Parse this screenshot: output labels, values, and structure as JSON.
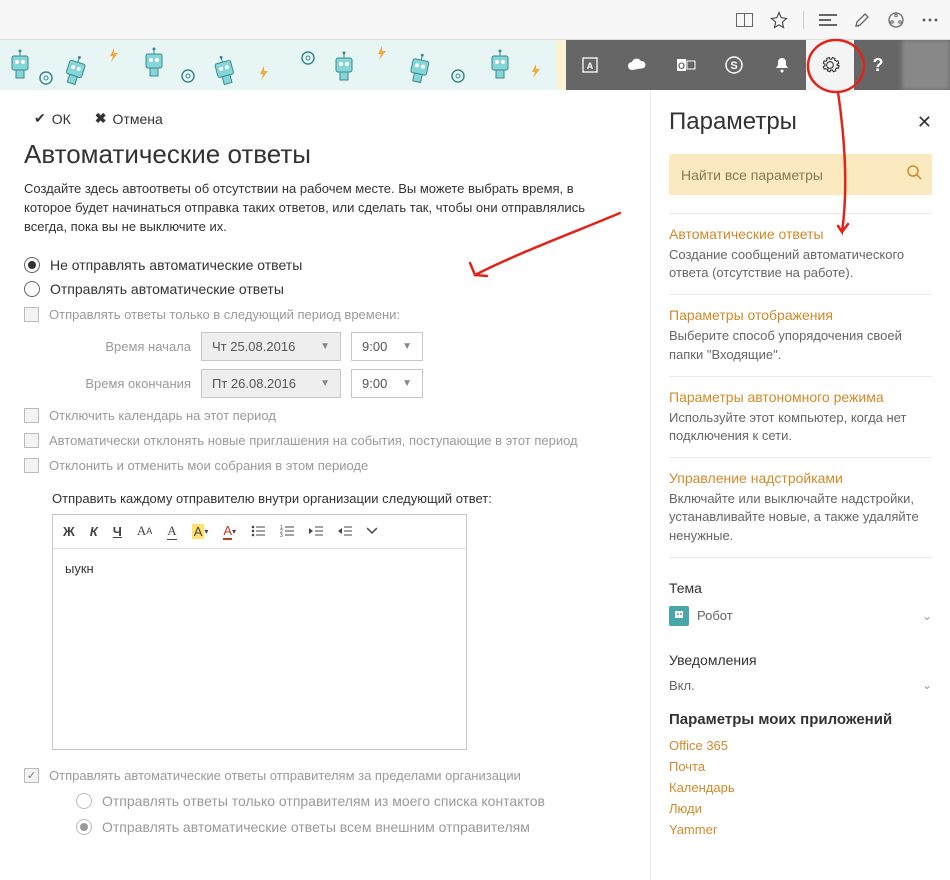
{
  "browser": {
    "icons": [
      "read",
      "star",
      "hub",
      "notes",
      "share",
      "more"
    ]
  },
  "appbar": {
    "icons": [
      "apps",
      "onedrive",
      "outlook",
      "skype",
      "notifications",
      "settings",
      "help"
    ],
    "active_icon": "settings"
  },
  "main": {
    "ok_label": "ОК",
    "cancel_label": "Отмена",
    "title": "Автоматические ответы",
    "description": "Создайте здесь автоответы об отсутствии на рабочем месте. Вы можете выбрать время, в которое будет начинаться отправка таких ответов, или сделать так, чтобы они отправлялись всегда, пока вы не выключите их.",
    "radio_dont_send": "Не отправлять автоматические ответы",
    "radio_send": "Отправлять автоматические ответы",
    "chk_period": "Отправлять ответы только в следующий период времени:",
    "start_label": "Время начала",
    "start_date": "Чт 25.08.2016",
    "start_time": "9:00",
    "end_label": "Время окончания",
    "end_date": "Пт 26.08.2016",
    "end_time": "9:00",
    "chk_block_cal": "Отключить календарь на этот период",
    "chk_decline_new": "Автоматически отклонять новые приглашения на события, поступающие в этот период",
    "chk_decline_existing": "Отклонить и отменить мои собрания в этом периоде",
    "inside_label": "Отправить каждому отправителю внутри организации следующий ответ:",
    "editor_content": "ыукн",
    "chk_outside": "Отправлять автоматические ответы отправителям за пределами организации",
    "radio_contacts_only": "Отправлять ответы только отправителям из моего списка контактов",
    "radio_all_external": "Отправлять автоматические ответы всем внешним отправителям"
  },
  "sidepanel": {
    "title": "Параметры",
    "search_placeholder": "Найти все параметры",
    "sections": {
      "auto": {
        "title": "Автоматические ответы",
        "desc": "Создание сообщений автоматического ответа (отсутствие на работе)."
      },
      "display": {
        "title": "Параметры отображения",
        "desc": "Выберите способ упорядочения своей папки \"Входящие\"."
      },
      "offline": {
        "title": "Параметры автономного режима",
        "desc": "Используйте этот компьютер, когда нет подключения к сети."
      },
      "addins": {
        "title": "Управление надстройками",
        "desc": "Включайте или выключайте надстройки, устанавливайте новые, а также удаляйте ненужные."
      }
    },
    "theme_label": "Тема",
    "theme_value": "Робот",
    "notifications_label": "Уведомления",
    "notifications_value": "Вкл.",
    "myapps_header": "Параметры моих приложений",
    "apps": [
      "Office 365",
      "Почта",
      "Календарь",
      "Люди",
      "Yammer"
    ]
  }
}
